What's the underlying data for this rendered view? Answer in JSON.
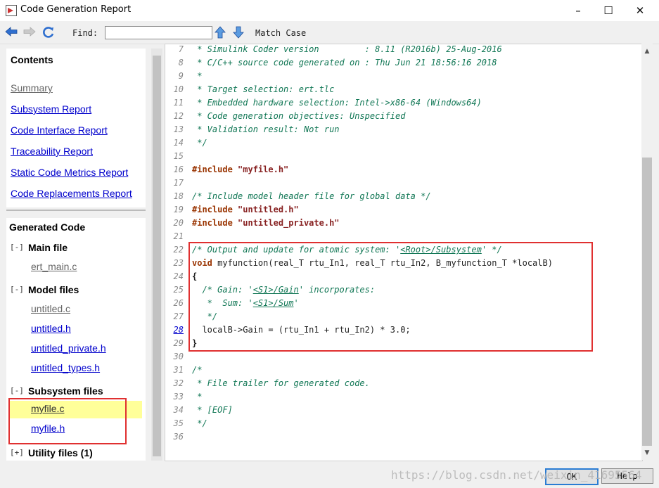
{
  "window": {
    "title": "Code Generation Report",
    "minimize": "–",
    "maximize": "☐",
    "close": "✕"
  },
  "toolbar": {
    "find_label": "Find:",
    "find_value": "",
    "match_case": "Match Case"
  },
  "contents": {
    "heading": "Contents",
    "links": [
      "Summary",
      "Subsystem Report",
      "Code Interface Report",
      "Traceability Report",
      "Static Code Metrics Report",
      "Code Replacements Report"
    ]
  },
  "generated": {
    "heading": "Generated Code",
    "main": {
      "toggle": "[-]",
      "label": "Main file",
      "files": [
        "ert_main.c"
      ]
    },
    "model": {
      "toggle": "[-]",
      "label": "Model files",
      "files": [
        "untitled.c",
        "untitled.h",
        "untitled_private.h",
        "untitled_types.h"
      ]
    },
    "subsystem": {
      "toggle": "[-]",
      "label": "Subsystem files",
      "files": [
        "myfile.c",
        "myfile.h"
      ]
    },
    "utility": {
      "toggle": "[+]",
      "label": "Utility files (1)"
    }
  },
  "code": {
    "l7": {
      "n": "7",
      "t": " * Simulink Coder version         : 8.11 (R2016b) 25-Aug-2016"
    },
    "l8": {
      "n": "8",
      "t": " * C/C++ source code generated on : Thu Jun 21 18:56:16 2018"
    },
    "l9": {
      "n": "9",
      "t": " *"
    },
    "l10": {
      "n": "10",
      "t": " * Target selection: ert.tlc"
    },
    "l11": {
      "n": "11",
      "t": " * Embedded hardware selection: Intel->x86-64 (Windows64)"
    },
    "l12": {
      "n": "12",
      "t": " * Code generation objectives: Unspecified"
    },
    "l13": {
      "n": "13",
      "t": " * Validation result: Not run"
    },
    "l14": {
      "n": "14",
      "t": " */"
    },
    "l15": {
      "n": "15"
    },
    "l16": {
      "n": "16",
      "kw": "#include",
      "str": " \"myfile.h\""
    },
    "l17": {
      "n": "17"
    },
    "l18": {
      "n": "18",
      "t": "/* Include model header file for global data */"
    },
    "l19": {
      "n": "19",
      "kw": "#include",
      "str": " \"untitled.h\""
    },
    "l20": {
      "n": "20",
      "kw": "#include",
      "str": " \"untitled_private.h\""
    },
    "l21": {
      "n": "21"
    },
    "l22": {
      "n": "22",
      "a": "/* Output and update for atomic system: '",
      "link": "<Root>/Subsystem",
      "b": "' */"
    },
    "l23": {
      "n": "23",
      "kw": "void",
      "rest": " myfunction(real_T rtu_In1, real_T rtu_In2, B_myfunction_T *localB)"
    },
    "l24": {
      "n": "24",
      "rest": "{"
    },
    "l25": {
      "n": "25",
      "a": "  /* Gain: '",
      "link": "<S1>/Gain",
      "b": "' incorporates:"
    },
    "l26": {
      "n": "26",
      "a": "   *  Sum: '",
      "link": "<S1>/Sum",
      "b": "'"
    },
    "l27": {
      "n": "27",
      "t": "   */"
    },
    "l28": {
      "n": "28",
      "rest": "  localB->Gain = (rtu_In1 + rtu_In2) * 3.0;"
    },
    "l29": {
      "n": "29",
      "rest": "}"
    },
    "l30": {
      "n": "30"
    },
    "l31": {
      "n": "31",
      "t": "/*"
    },
    "l32": {
      "n": "32",
      "t": " * File trailer for generated code."
    },
    "l33": {
      "n": "33",
      "t": " *"
    },
    "l34": {
      "n": "34",
      "t": " * [EOF]"
    },
    "l35": {
      "n": "35",
      "t": " */"
    },
    "l36": {
      "n": "36"
    }
  },
  "buttons": {
    "ok": "OK",
    "help": "Help"
  },
  "watermark": "https://blog.csdn.net/weixin_41695564"
}
